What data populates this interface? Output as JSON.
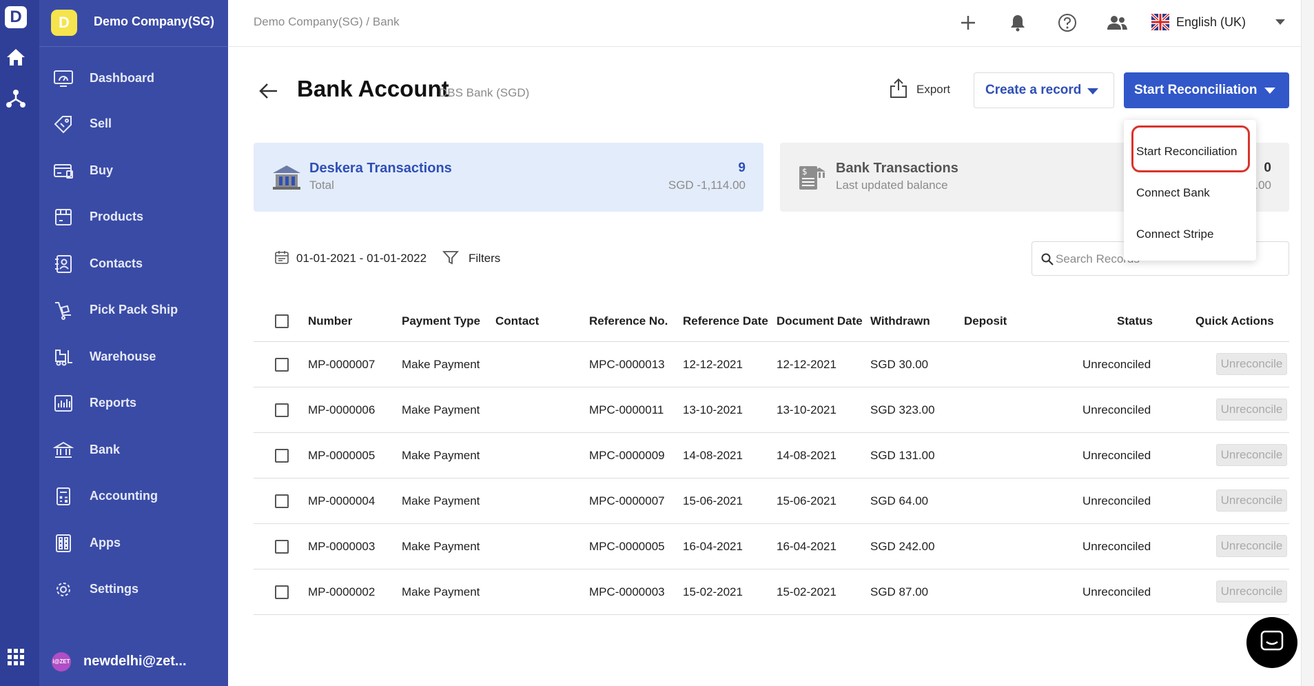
{
  "rail": {
    "logo_letter": "D"
  },
  "company": {
    "logo_letter": "D",
    "name": "Demo Company(SG)"
  },
  "sidebar": {
    "items": [
      {
        "label": "Dashboard",
        "icon": "dashboard-icon"
      },
      {
        "label": "Sell",
        "icon": "sell-tag-icon"
      },
      {
        "label": "Buy",
        "icon": "buy-card-icon"
      },
      {
        "label": "Products",
        "icon": "products-box-icon"
      },
      {
        "label": "Contacts",
        "icon": "contacts-book-icon"
      },
      {
        "label": "Pick Pack Ship",
        "icon": "pick-pack-ship-icon"
      },
      {
        "label": "Warehouse",
        "icon": "warehouse-forklift-icon"
      },
      {
        "label": "Reports",
        "icon": "reports-chart-icon"
      },
      {
        "label": "Bank",
        "icon": "bank-icon"
      },
      {
        "label": "Accounting",
        "icon": "accounting-calculator-icon"
      },
      {
        "label": "Apps",
        "icon": "apps-icon"
      },
      {
        "label": "Settings",
        "icon": "settings-gear-icon"
      }
    ]
  },
  "user": {
    "avatar_text": "i@ZET",
    "name": "newdelhi@zet..."
  },
  "topbar": {
    "breadcrumb": "Demo Company(SG) / Bank",
    "language": "English (UK)"
  },
  "header": {
    "title": "Bank Account",
    "subtitle": "DBS Bank (SGD)",
    "export_label": "Export",
    "create_label": "Create a record",
    "start_label": "Start Reconciliation"
  },
  "cards": {
    "deskera": {
      "title": "Deskera Transactions",
      "subtitle": "Total",
      "count": "9",
      "amount": "SGD -1,114.00"
    },
    "bank": {
      "title": "Bank Transactions",
      "subtitle": "Last updated balance",
      "count": "0",
      "amount": ".00"
    }
  },
  "filters": {
    "date_range": "01-01-2021 - 01-01-2022",
    "filters_label": "Filters",
    "search_placeholder": "Search Records"
  },
  "table": {
    "columns": [
      "Number",
      "Payment Type",
      "Contact",
      "Reference No.",
      "Reference Date",
      "Document Date",
      "Withdrawn",
      "Deposit",
      "Status",
      "Quick Actions"
    ],
    "rows": [
      {
        "number": "MP-0000007",
        "payment_type": "Make Payment",
        "contact": "",
        "reference_no": "MPC-0000013",
        "reference_date": "12-12-2021",
        "document_date": "12-12-2021",
        "withdrawn": "SGD 30.00",
        "deposit": "",
        "status": "Unreconciled",
        "action": "Unreconcile"
      },
      {
        "number": "MP-0000006",
        "payment_type": "Make Payment",
        "contact": "",
        "reference_no": "MPC-0000011",
        "reference_date": "13-10-2021",
        "document_date": "13-10-2021",
        "withdrawn": "SGD 323.00",
        "deposit": "",
        "status": "Unreconciled",
        "action": "Unreconcile"
      },
      {
        "number": "MP-0000005",
        "payment_type": "Make Payment",
        "contact": "",
        "reference_no": "MPC-0000009",
        "reference_date": "14-08-2021",
        "document_date": "14-08-2021",
        "withdrawn": "SGD 131.00",
        "deposit": "",
        "status": "Unreconciled",
        "action": "Unreconcile"
      },
      {
        "number": "MP-0000004",
        "payment_type": "Make Payment",
        "contact": "",
        "reference_no": "MPC-0000007",
        "reference_date": "15-06-2021",
        "document_date": "15-06-2021",
        "withdrawn": "SGD 64.00",
        "deposit": "",
        "status": "Unreconciled",
        "action": "Unreconcile"
      },
      {
        "number": "MP-0000003",
        "payment_type": "Make Payment",
        "contact": "",
        "reference_no": "MPC-0000005",
        "reference_date": "16-04-2021",
        "document_date": "16-04-2021",
        "withdrawn": "SGD 242.00",
        "deposit": "",
        "status": "Unreconciled",
        "action": "Unreconcile"
      },
      {
        "number": "MP-0000002",
        "payment_type": "Make Payment",
        "contact": "",
        "reference_no": "MPC-0000003",
        "reference_date": "15-02-2021",
        "document_date": "15-02-2021",
        "withdrawn": "SGD 87.00",
        "deposit": "",
        "status": "Unreconciled",
        "action": "Unreconcile"
      }
    ]
  },
  "dropdown": {
    "items": [
      "Start Reconciliation",
      "Connect Bank",
      "Connect Stripe"
    ],
    "highlighted": "Start Reconciliation"
  },
  "colors": {
    "sidebar": "#3a4ba6",
    "rail": "#2f3f97",
    "primary_button": "#3157c9",
    "link": "#2f4fb6",
    "highlight_outline": "#d9342b",
    "deskera_card": "#e3ecfa"
  }
}
